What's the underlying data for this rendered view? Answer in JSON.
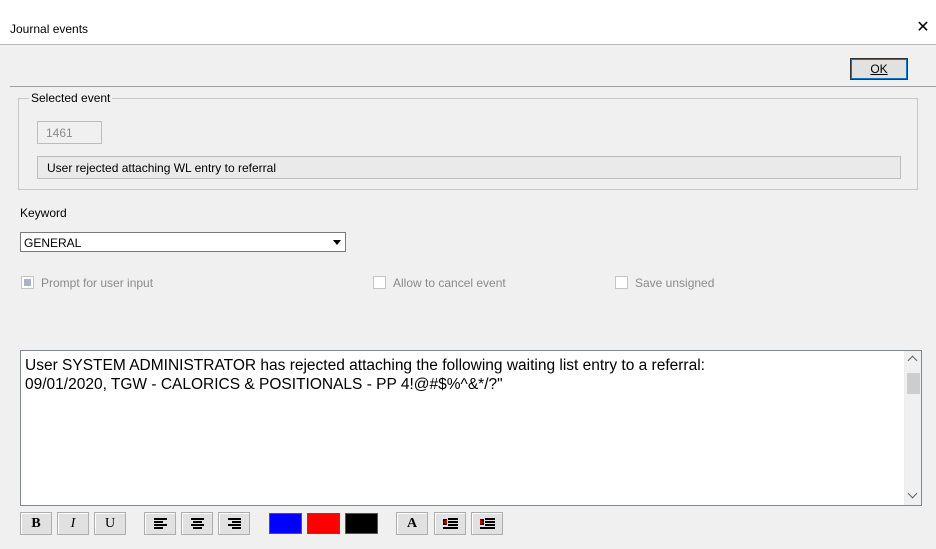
{
  "window": {
    "title": "Journal events",
    "close_glyph": "✕"
  },
  "toolbar": {
    "ok_label": "OK"
  },
  "selected_event": {
    "legend": "Selected event",
    "id": "1461",
    "description": "User rejected attaching WL entry to referral"
  },
  "keyword": {
    "label": "Keyword",
    "value": "GENERAL"
  },
  "options": {
    "prompt": {
      "label": "Prompt for user input",
      "checked": true
    },
    "allow_cancel": {
      "label": "Allow to cancel event",
      "checked": false
    },
    "save_unsigned": {
      "label": "Save unsigned",
      "checked": false
    }
  },
  "editor": {
    "text": "User SYSTEM ADMINISTRATOR has rejected attaching the following waiting list entry to a referral:\n09/01/2020, TGW - CALORICS & POSITIONALS - PP 4!@#$%^&*/?\""
  },
  "format": {
    "bold": "B",
    "italic": "I",
    "underline": "U",
    "font": "A",
    "colors": {
      "blue": "#0000ff",
      "red": "#ff0000",
      "black": "#000000"
    }
  }
}
